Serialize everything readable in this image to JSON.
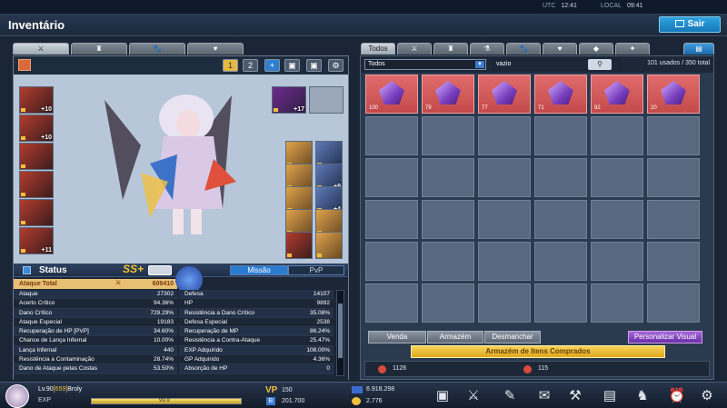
{
  "topbar": {
    "utc_label": "UTC",
    "utc_time": "12:41",
    "local_label": "LOCAL",
    "local_time": "09:41"
  },
  "header": {
    "title": "Inventário",
    "exit_label": "Sair"
  },
  "equip": {
    "page1": "1",
    "page2": "2",
    "plus": "+"
  },
  "left_slots": [
    {
      "plus": "+10"
    },
    {
      "plus": "+10"
    },
    {
      "plus": ""
    },
    {
      "plus": ""
    },
    {
      "plus": ""
    },
    {
      "plus": "+11"
    }
  ],
  "weapon_slot": {
    "plus": "+17"
  },
  "right_slots": [
    {
      "plus": ""
    },
    {
      "plus": ""
    },
    {
      "plus": ""
    },
    {
      "plus": "+9"
    },
    {
      "plus": ""
    },
    {
      "plus": "+4"
    },
    {
      "plus": ""
    },
    {
      "plus": ""
    },
    {
      "plus": ""
    },
    {
      "plus": ""
    }
  ],
  "status": {
    "title": "Status",
    "rank": "SS+",
    "tab_mission": "Missão",
    "tab_pvp": "PvP",
    "total_label": "Ataque Total",
    "total_value": "609410",
    "left": [
      {
        "k": "Ataque",
        "v": "27302"
      },
      {
        "k": "Acerto Crítico",
        "v": "94.36%"
      },
      {
        "k": "Dano Crítico",
        "v": "729.29%"
      },
      {
        "k": "Ataque Especial",
        "v": "19183"
      },
      {
        "k": "Recuperação de HP [PVP]",
        "v": "34.60%"
      },
      {
        "k": "Chance de Lança Infernal",
        "v": "10.00%"
      },
      {
        "k": "Lança Infernal",
        "v": "440"
      },
      {
        "k": "Resistência a Contaminação",
        "v": "28.74%"
      },
      {
        "k": "Dano de Ataque pelas Costas",
        "v": "53.50%"
      }
    ],
    "right": [
      {
        "k": "Defesa",
        "v": "14107"
      },
      {
        "k": "HP",
        "v": "9892"
      },
      {
        "k": "Resistência a Dano Crítico",
        "v": "35.08%"
      },
      {
        "k": "Defesa Especial",
        "v": "2538"
      },
      {
        "k": "Recuperação de MP",
        "v": "86.24%"
      },
      {
        "k": "Resistência a Contra-Ataque",
        "v": "25.47%"
      },
      {
        "k": "EXP Adquirido",
        "v": "108.00%"
      },
      {
        "k": "GP Adquirido",
        "v": "4.36%"
      },
      {
        "k": "Absorção de HP",
        "v": "0"
      }
    ]
  },
  "inventory": {
    "tab_all": "Todos",
    "filter": "Todos",
    "search": "vazio",
    "usage": "101 usados / 350 total",
    "items": [
      {
        "count": "100"
      },
      {
        "count": "79"
      },
      {
        "count": "77"
      },
      {
        "count": "71"
      },
      {
        "count": "92"
      },
      {
        "count": "20"
      }
    ],
    "btn_sell": "Venda",
    "btn_storage": "Armazém",
    "btn_dismantle": "Desmanchar",
    "btn_custom": "Personalizar Visual",
    "storage_bar": "Armazém de Itens Comprados",
    "currency1": "1128",
    "currency2": "115"
  },
  "bottom": {
    "level": "Lv.90",
    "guild": "[659]",
    "name": "Broly",
    "exp_label": "EXP",
    "exp_value": "99.9",
    "exp_progress": 0.999,
    "vp_label": "VP",
    "vp_value": "150",
    "bp_label": "B",
    "bp_value": "201.700",
    "gold1": "6.918.298",
    "gold2": "2.776"
  },
  "colors": {
    "accent": "#1a8fd0",
    "rank": "#f4c430",
    "item_bg": "#d65a5a"
  }
}
